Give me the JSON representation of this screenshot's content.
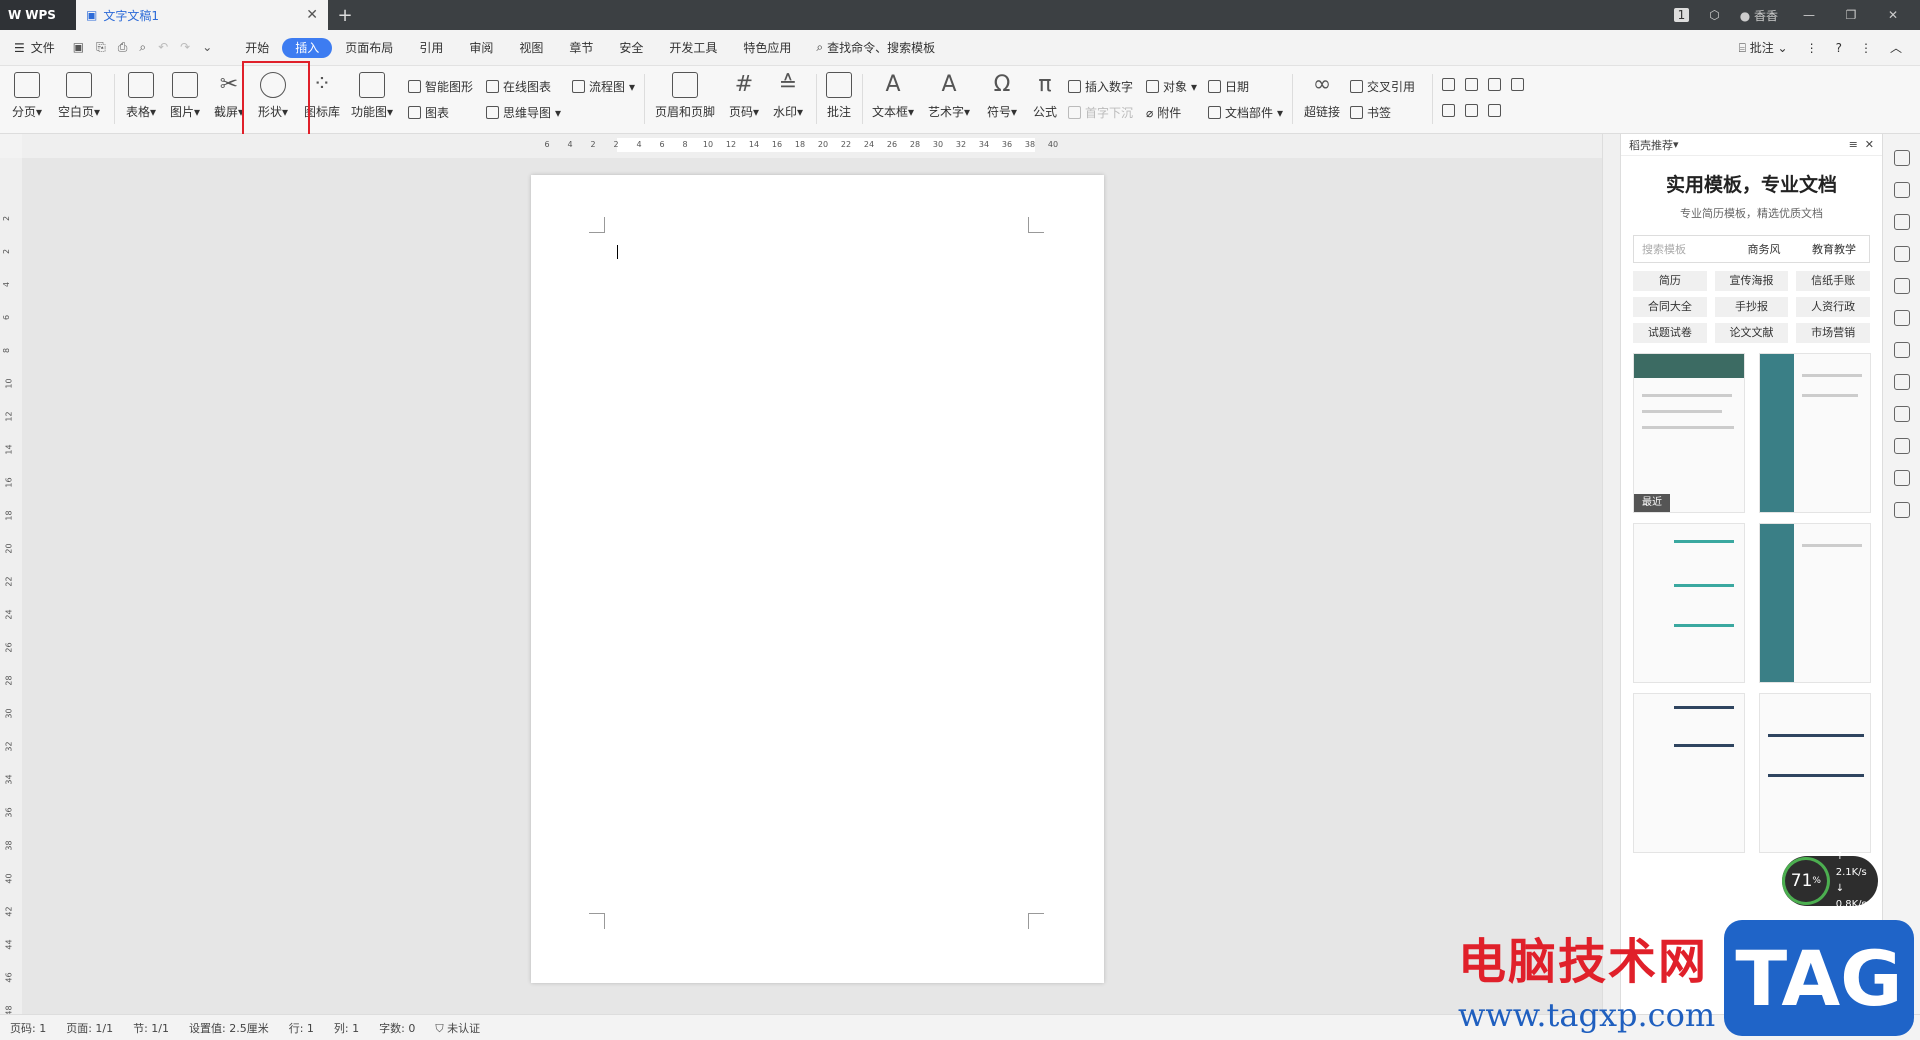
{
  "titlebar": {
    "app_label": "WPS",
    "doc_tab": "文字文稿1",
    "user": "香香",
    "badge": "1"
  },
  "menu": {
    "file": "文件",
    "tabs": [
      "开始",
      "插入",
      "页面布局",
      "引用",
      "审阅",
      "视图",
      "章节",
      "安全",
      "开发工具",
      "特色应用"
    ],
    "active_tab": "插入",
    "search": "查找命令、搜索模板",
    "comment": "批注"
  },
  "ribbon": {
    "page_break": "分页",
    "blank_page": "空白页",
    "table": "表格",
    "picture": "图片",
    "screenshot": "截屏",
    "shape": "形状",
    "icon_lib": "图标库",
    "func_chart": "功能图",
    "smart_graphic": "智能图形",
    "online_chart": "在线图表",
    "flowchart": "流程图",
    "chart": "图表",
    "mindmap": "思维导图",
    "header_footer": "页眉和页脚",
    "page_number": "页码",
    "watermark": "水印",
    "comment": "批注",
    "textbox": "文本框",
    "wordart": "艺术字",
    "symbol": "符号",
    "formula": "公式",
    "insert_number": "插入数字",
    "object": "对象",
    "date": "日期",
    "drop_cap": "首字下沉",
    "attachment": "附件",
    "doc_parts": "文档部件",
    "hyperlink": "超链接",
    "cross_ref": "交叉引用",
    "bookmark": "书签"
  },
  "ruler": {
    "h_ticks": [
      "6",
      "4",
      "2",
      "2",
      "4",
      "6",
      "8",
      "10",
      "12",
      "14",
      "16",
      "18",
      "20",
      "22",
      "24",
      "26",
      "28",
      "30",
      "32",
      "34",
      "36",
      "38",
      "40"
    ],
    "v_ticks": [
      "2",
      "2",
      "4",
      "6",
      "8",
      "10",
      "12",
      "14",
      "16",
      "18",
      "20",
      "22",
      "24",
      "26",
      "28",
      "30",
      "32",
      "34",
      "36",
      "38",
      "40",
      "42",
      "44",
      "46",
      "48"
    ]
  },
  "panel": {
    "header": "稻壳推荐",
    "title": "实用模板，专业文档",
    "subtitle": "专业简历模板，精选优质文档",
    "search_placeholder": "搜索模板",
    "search_opts": [
      "商务风",
      "教育教学"
    ],
    "chips": [
      "简历",
      "宣传海报",
      "信纸手账",
      "合同大全",
      "手抄报",
      "人资行政",
      "试题试卷",
      "论文文献",
      "市场营销"
    ],
    "recent_label": "最近"
  },
  "network": {
    "percent": "71",
    "percent_unit": "%",
    "up": "2.1",
    "down": "0.8",
    "rate_unit": "K/s"
  },
  "status": {
    "page_code": "页码: 1",
    "page": "页面: 1/1",
    "section": "节: 1/1",
    "setting": "设置值: 2.5厘米",
    "row": "行: 1",
    "col": "列: 1",
    "words": "字数: 0",
    "cert": "未认证"
  },
  "watermark": {
    "title": "电脑技术网",
    "url": "www.tagxp.com",
    "tag": "TAG"
  }
}
